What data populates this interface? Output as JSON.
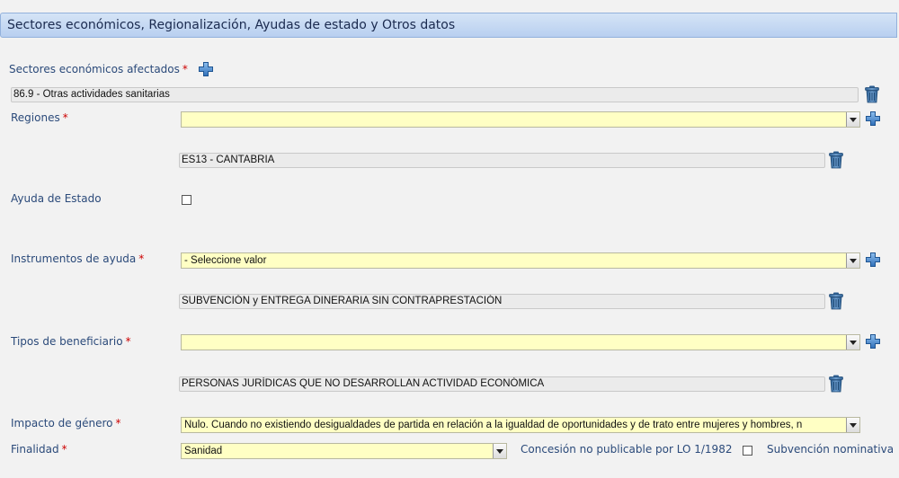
{
  "section_title": "Sectores económicos, Regionalización, Ayudas de estado y Otros datos",
  "required_mark": "*",
  "icons": {
    "add": "plus-icon",
    "delete": "trash-icon",
    "dropdown": "chevron-down-icon"
  },
  "colors": {
    "label": "#2b4a7a",
    "required": "#cc0000",
    "select_bg": "#ffffc4",
    "header_bg": "#c6d9f3"
  },
  "sectores": {
    "label": "Sectores económicos afectados",
    "items": [
      "86.9 - Otras actividades sanitarias"
    ]
  },
  "regiones": {
    "label": "Regiones",
    "select_value": "",
    "items": [
      "ES13 - CANTABRIA"
    ]
  },
  "ayuda_estado": {
    "label": "Ayuda de Estado",
    "checked": false
  },
  "instrumentos": {
    "label": "Instrumentos de ayuda",
    "select_value": "- Seleccione valor",
    "items": [
      "SUBVENCIÓN y ENTREGA DINERARIA SIN CONTRAPRESTACIÓN"
    ]
  },
  "tipos_beneficiario": {
    "label": "Tipos de beneficiario",
    "select_value": "",
    "items": [
      "PERSONAS JURÍDICAS QUE NO DESARROLLAN ACTIVIDAD ECONÓMICA"
    ]
  },
  "impacto_genero": {
    "label": "Impacto de género",
    "select_value": "Nulo. Cuando no existiendo desigualdades de partida en relación a la igualdad de oportunidades y de trato entre mujeres y hombres, n"
  },
  "finalidad": {
    "label": "Finalidad",
    "select_value": "Sanidad"
  },
  "concesion": {
    "label": "Concesión no publicable por LO 1/1982",
    "checked": false
  },
  "subvencion_nominativa": {
    "label": "Subvención nominativa"
  }
}
